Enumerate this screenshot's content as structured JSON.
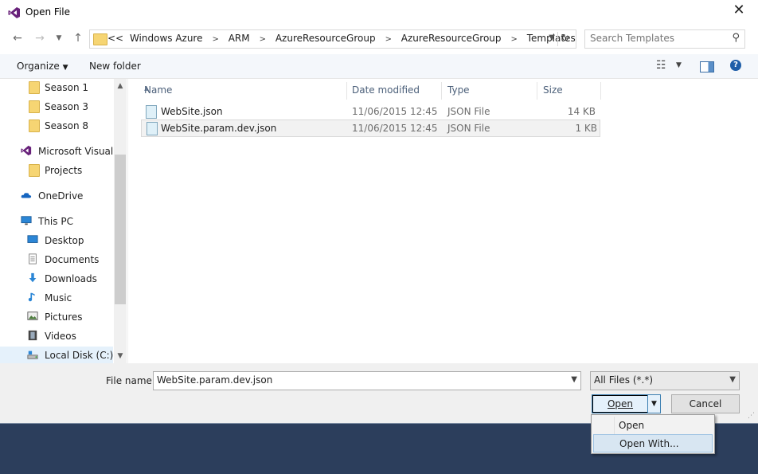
{
  "window": {
    "title": "Open File"
  },
  "nav": {
    "breadcrumbs": [
      "Windows Azure",
      "ARM",
      "AzureResourceGroup",
      "AzureResourceGroup",
      "Templates"
    ],
    "overflow": "<<",
    "search_placeholder": "Search Templates"
  },
  "toolbar": {
    "organize": "Organize",
    "new_folder": "New folder"
  },
  "sidebar": {
    "items": [
      {
        "label": "Season 1",
        "icon": "folder-icon"
      },
      {
        "label": "Season 3",
        "icon": "folder-icon"
      },
      {
        "label": "Season 8",
        "icon": "folder-icon"
      },
      {
        "label": "Microsoft Visual S",
        "icon": "visual-studio-icon"
      },
      {
        "label": "Projects",
        "icon": "folder-icon"
      },
      {
        "label": "OneDrive",
        "icon": "onedrive-icon"
      },
      {
        "label": "This PC",
        "icon": "computer-icon"
      },
      {
        "label": "Desktop",
        "icon": "desktop-icon"
      },
      {
        "label": "Documents",
        "icon": "documents-icon"
      },
      {
        "label": "Downloads",
        "icon": "downloads-icon"
      },
      {
        "label": "Music",
        "icon": "music-icon"
      },
      {
        "label": "Pictures",
        "icon": "pictures-icon"
      },
      {
        "label": "Videos",
        "icon": "videos-icon"
      },
      {
        "label": "Local Disk (C:)",
        "icon": "disk-icon"
      }
    ]
  },
  "files": {
    "columns": [
      "Name",
      "Date modified",
      "Type",
      "Size"
    ],
    "rows": [
      {
        "name": "WebSite.json",
        "date": "11/06/2015 12:45",
        "type": "JSON File",
        "size": "14 KB"
      },
      {
        "name": "WebSite.param.dev.json",
        "date": "11/06/2015 12:45",
        "type": "JSON File",
        "size": "1 KB"
      }
    ]
  },
  "bottom": {
    "file_name_label": "File name:",
    "file_name_value": "WebSite.param.dev.json",
    "filter": "All Files (*.*)",
    "open_label": "Open",
    "cancel_label": "Cancel"
  },
  "open_menu": {
    "items": [
      "Open",
      "Open With..."
    ]
  },
  "colors": {
    "accent": "#3c7fb1",
    "background": "#2c3e5c",
    "vs_purple": "#68217a"
  }
}
